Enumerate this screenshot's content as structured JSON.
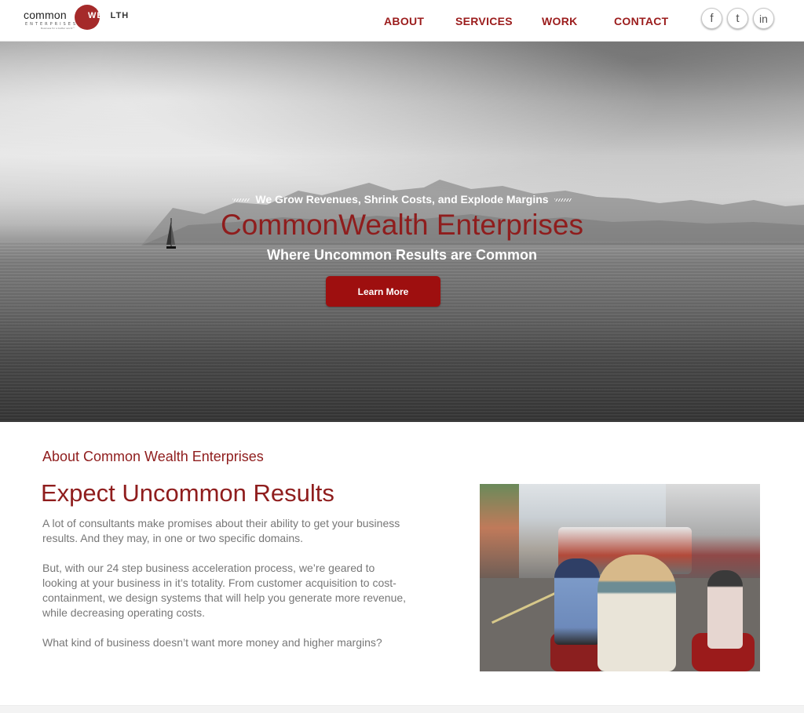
{
  "logo": {
    "common": "common",
    "wealth_initial": "WEA",
    "wealth_rest": "LTH",
    "sub": "ENTERPRISES",
    "tagline": "Business for a better world™"
  },
  "nav": {
    "about": "ABOUT",
    "services": "SERVICES",
    "work": "WORK",
    "contact": "CONTACT"
  },
  "social": {
    "facebook": "f",
    "twitter": "t",
    "linkedin": "in"
  },
  "hero": {
    "eyebrow": "We Grow Revenues, Shrink Costs, and Explode Margins",
    "title": "CommonWealth Enterprises",
    "subtitle": "Where Uncommon Results are Common",
    "button": "Learn More"
  },
  "about": {
    "eyebrow": "About Common Wealth Enterprises",
    "title": "Expect Uncommon Results",
    "paragraphs": [
      "A lot of consultants make promises about their ability to get your business results. And they may, in one or two specific domains.",
      "But, with our 24 step business acceleration process, we’re geared to looking at your business in it’s totality. From customer acquisition to cost-containment, we design systems that will help you generate more revenue, while decreasing operating costs.",
      "What kind of business doesn’t want more money and higher margins?"
    ]
  },
  "colors": {
    "brand_red": "#8f1d1d",
    "button_red": "#9e0f0f",
    "nav_red": "#9b1c1c"
  }
}
